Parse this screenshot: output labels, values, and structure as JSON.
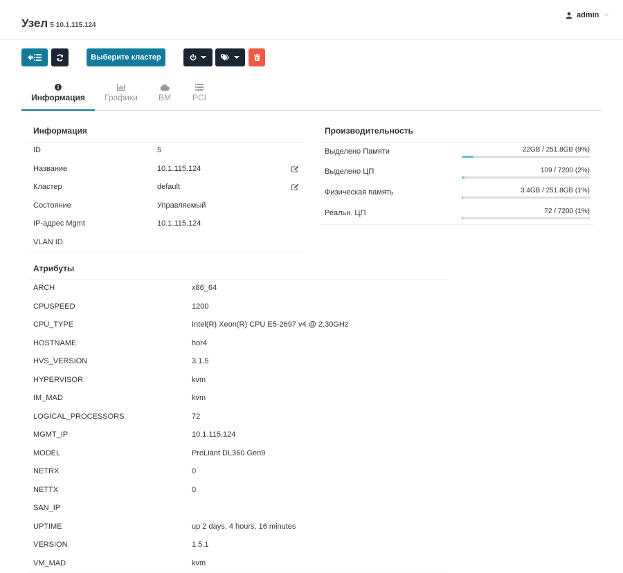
{
  "header": {
    "title": "Узел",
    "node_id": "5",
    "node_ip": "10.1.115.124",
    "user": "admin"
  },
  "toolbar": {
    "cluster_button": "Выберите кластер"
  },
  "tabs": [
    {
      "label": "Информация",
      "icon": "info-icon",
      "active": true
    },
    {
      "label": "Графики",
      "icon": "bar-chart-icon",
      "active": false
    },
    {
      "label": "ВМ",
      "icon": "cloud-icon",
      "active": false
    },
    {
      "label": "PCI",
      "icon": "list-icon",
      "active": false
    }
  ],
  "info": {
    "title": "Информация",
    "rows": [
      {
        "label": "ID",
        "value": "5"
      },
      {
        "label": "Название",
        "value": "10.1.115.124"
      },
      {
        "label": "Кластер",
        "value": "default"
      },
      {
        "label": "Состояние",
        "value": "Управляемый"
      },
      {
        "label": "IP-адрес Mgmt",
        "value": "10.1.115.124"
      },
      {
        "label": "VLAN ID",
        "value": ""
      }
    ]
  },
  "performance": {
    "title": "Производительность",
    "rows": [
      {
        "label": "Выделено Памяти",
        "value": "22GB / 251.8GB (9%)",
        "percent": 9
      },
      {
        "label": "Выделено ЦП",
        "value": "109 / 7200 (2%)",
        "percent": 2
      },
      {
        "label": "Физическая память",
        "value": "3.4GB / 251.8GB (1%)",
        "percent": 1
      },
      {
        "label": "Реальн. ЦП",
        "value": "72 / 7200 (1%)",
        "percent": 1
      }
    ]
  },
  "attributes": {
    "title": "Атрибуты",
    "rows": [
      {
        "key": "ARCH",
        "value": "x86_64"
      },
      {
        "key": "CPUSPEED",
        "value": "1200"
      },
      {
        "key": "CPU_TYPE",
        "value": "Intel(R) Xeon(R) CPU E5-2697 v4 @ 2.30GHz"
      },
      {
        "key": "HOSTNAME",
        "value": "hor4"
      },
      {
        "key": "HVS_VERSION",
        "value": "3.1.5"
      },
      {
        "key": "HYPERVISOR",
        "value": "kvm"
      },
      {
        "key": "IM_MAD",
        "value": "kvm"
      },
      {
        "key": "LOGICAL_PROCESSORS",
        "value": "72"
      },
      {
        "key": "MGMT_IP",
        "value": "10.1.115.124"
      },
      {
        "key": "MODEL",
        "value": "ProLiant DL360 Gen9"
      },
      {
        "key": "NETRX",
        "value": "0"
      },
      {
        "key": "NETTX",
        "value": "0"
      },
      {
        "key": "SAN_IP",
        "value": ""
      },
      {
        "key": "UPTIME",
        "value": "up 2 days, 4 hours, 16 minutes"
      },
      {
        "key": "VERSION",
        "value": "1.5.1"
      },
      {
        "key": "VM_MAD",
        "value": "kvm"
      }
    ]
  },
  "colors": {
    "accent": "#127b9c",
    "dark_button": "#1c2633",
    "danger": "#ee5a45",
    "bar_fill": "#6bbcd6"
  }
}
